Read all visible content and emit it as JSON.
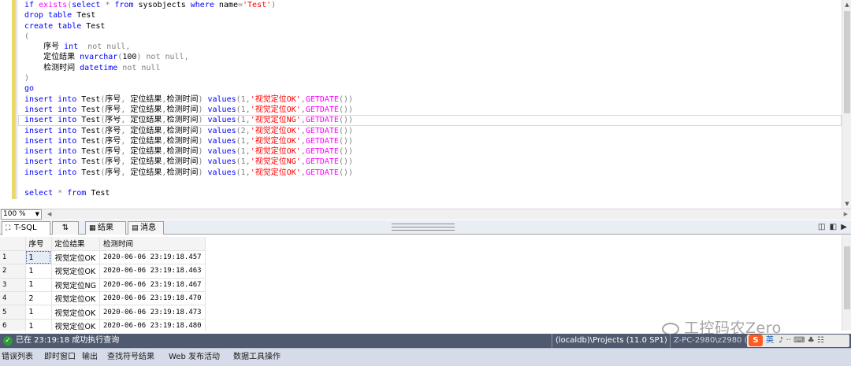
{
  "editor": {
    "lines": [
      [
        {
          "t": "if ",
          "c": "kw"
        },
        {
          "t": "exists",
          "c": "fn"
        },
        {
          "t": "(",
          "c": "gr"
        },
        {
          "t": "select ",
          "c": "kw"
        },
        {
          "t": "* ",
          "c": "gr"
        },
        {
          "t": "from ",
          "c": "kw"
        },
        {
          "t": "sysobjects ",
          "c": ""
        },
        {
          "t": "where ",
          "c": "kw"
        },
        {
          "t": "name",
          "c": ""
        },
        {
          "t": "=",
          "c": "gr"
        },
        {
          "t": "'Test'",
          "c": "str"
        },
        {
          "t": ")",
          "c": "gr"
        }
      ],
      [
        {
          "t": "drop table ",
          "c": "kw"
        },
        {
          "t": "Test",
          "c": ""
        }
      ],
      [
        {
          "t": "create table ",
          "c": "kw"
        },
        {
          "t": "Test",
          "c": ""
        }
      ],
      [
        {
          "t": "(",
          "c": "gr"
        }
      ],
      [
        {
          "t": "    序号 ",
          "c": ""
        },
        {
          "t": "int  ",
          "c": "kw"
        },
        {
          "t": "not null,",
          "c": "gr"
        }
      ],
      [
        {
          "t": "    定位结果 ",
          "c": ""
        },
        {
          "t": "nvarchar",
          "c": "kw"
        },
        {
          "t": "(",
          "c": "gr"
        },
        {
          "t": "100",
          "c": ""
        },
        {
          "t": ") not null,",
          "c": "gr"
        }
      ],
      [
        {
          "t": "    检测时间 ",
          "c": ""
        },
        {
          "t": "datetime ",
          "c": "kw"
        },
        {
          "t": "not null",
          "c": "gr"
        }
      ],
      [
        {
          "t": ")",
          "c": "gr"
        }
      ],
      [
        {
          "t": "go",
          "c": "kw"
        }
      ],
      [
        {
          "t": "insert into ",
          "c": "kw"
        },
        {
          "t": "Test",
          "c": ""
        },
        {
          "t": "(",
          "c": "gr"
        },
        {
          "t": "序号",
          "c": ""
        },
        {
          "t": ", ",
          "c": "gr"
        },
        {
          "t": "定位结果",
          "c": ""
        },
        {
          "t": ",",
          "c": "gr"
        },
        {
          "t": "检测时间",
          "c": ""
        },
        {
          "t": ") ",
          "c": "gr"
        },
        {
          "t": "values",
          "c": "kw"
        },
        {
          "t": "(1,",
          "c": "gr"
        },
        {
          "t": "'视觉定位OK'",
          "c": "str"
        },
        {
          "t": ",",
          "c": "gr"
        },
        {
          "t": "GETDATE",
          "c": "fn"
        },
        {
          "t": "())",
          "c": "gr"
        }
      ],
      [
        {
          "t": "insert into ",
          "c": "kw"
        },
        {
          "t": "Test",
          "c": ""
        },
        {
          "t": "(",
          "c": "gr"
        },
        {
          "t": "序号",
          "c": ""
        },
        {
          "t": ", ",
          "c": "gr"
        },
        {
          "t": "定位结果",
          "c": ""
        },
        {
          "t": ",",
          "c": "gr"
        },
        {
          "t": "检测时间",
          "c": ""
        },
        {
          "t": ") ",
          "c": "gr"
        },
        {
          "t": "values",
          "c": "kw"
        },
        {
          "t": "(1,",
          "c": "gr"
        },
        {
          "t": "'视觉定位OK'",
          "c": "str"
        },
        {
          "t": ",",
          "c": "gr"
        },
        {
          "t": "GETDATE",
          "c": "fn"
        },
        {
          "t": "())",
          "c": "gr"
        }
      ],
      [
        {
          "t": "insert into ",
          "c": "kw"
        },
        {
          "t": "Test",
          "c": ""
        },
        {
          "t": "(",
          "c": "gr"
        },
        {
          "t": "序号",
          "c": ""
        },
        {
          "t": ", ",
          "c": "gr"
        },
        {
          "t": "定位结果",
          "c": ""
        },
        {
          "t": ",",
          "c": "gr"
        },
        {
          "t": "检测时间",
          "c": ""
        },
        {
          "t": ") ",
          "c": "gr"
        },
        {
          "t": "values",
          "c": "kw"
        },
        {
          "t": "(1,",
          "c": "gr"
        },
        {
          "t": "'视觉定位NG'",
          "c": "str"
        },
        {
          "t": ",",
          "c": "gr"
        },
        {
          "t": "GETDATE",
          "c": "fn"
        },
        {
          "t": "())",
          "c": "gr"
        }
      ],
      [
        {
          "t": "insert into ",
          "c": "kw"
        },
        {
          "t": "Test",
          "c": ""
        },
        {
          "t": "(",
          "c": "gr"
        },
        {
          "t": "序号",
          "c": ""
        },
        {
          "t": ", ",
          "c": "gr"
        },
        {
          "t": "定位结果",
          "c": ""
        },
        {
          "t": ",",
          "c": "gr"
        },
        {
          "t": "检测时间",
          "c": ""
        },
        {
          "t": ") ",
          "c": "gr"
        },
        {
          "t": "values",
          "c": "kw"
        },
        {
          "t": "(2,",
          "c": "gr"
        },
        {
          "t": "'视觉定位OK'",
          "c": "str"
        },
        {
          "t": ",",
          "c": "gr"
        },
        {
          "t": "GETDATE",
          "c": "fn"
        },
        {
          "t": "())",
          "c": "gr"
        }
      ],
      [
        {
          "t": "insert into ",
          "c": "kw"
        },
        {
          "t": "Test",
          "c": ""
        },
        {
          "t": "(",
          "c": "gr"
        },
        {
          "t": "序号",
          "c": ""
        },
        {
          "t": ", ",
          "c": "gr"
        },
        {
          "t": "定位结果",
          "c": ""
        },
        {
          "t": ",",
          "c": "gr"
        },
        {
          "t": "检测时间",
          "c": ""
        },
        {
          "t": ") ",
          "c": "gr"
        },
        {
          "t": "values",
          "c": "kw"
        },
        {
          "t": "(1,",
          "c": "gr"
        },
        {
          "t": "'视觉定位OK'",
          "c": "str"
        },
        {
          "t": ",",
          "c": "gr"
        },
        {
          "t": "GETDATE",
          "c": "fn"
        },
        {
          "t": "())",
          "c": "gr"
        }
      ],
      [
        {
          "t": "insert into ",
          "c": "kw"
        },
        {
          "t": "Test",
          "c": ""
        },
        {
          "t": "(",
          "c": "gr"
        },
        {
          "t": "序号",
          "c": ""
        },
        {
          "t": ", ",
          "c": "gr"
        },
        {
          "t": "定位结果",
          "c": ""
        },
        {
          "t": ",",
          "c": "gr"
        },
        {
          "t": "检测时间",
          "c": ""
        },
        {
          "t": ") ",
          "c": "gr"
        },
        {
          "t": "values",
          "c": "kw"
        },
        {
          "t": "(1,",
          "c": "gr"
        },
        {
          "t": "'视觉定位OK'",
          "c": "str"
        },
        {
          "t": ",",
          "c": "gr"
        },
        {
          "t": "GETDATE",
          "c": "fn"
        },
        {
          "t": "())",
          "c": "gr"
        }
      ],
      [
        {
          "t": "insert into ",
          "c": "kw"
        },
        {
          "t": "Test",
          "c": ""
        },
        {
          "t": "(",
          "c": "gr"
        },
        {
          "t": "序号",
          "c": ""
        },
        {
          "t": ", ",
          "c": "gr"
        },
        {
          "t": "定位结果",
          "c": ""
        },
        {
          "t": ",",
          "c": "gr"
        },
        {
          "t": "检测时间",
          "c": ""
        },
        {
          "t": ") ",
          "c": "gr"
        },
        {
          "t": "values",
          "c": "kw"
        },
        {
          "t": "(1,",
          "c": "gr"
        },
        {
          "t": "'视觉定位NG'",
          "c": "str"
        },
        {
          "t": ",",
          "c": "gr"
        },
        {
          "t": "GETDATE",
          "c": "fn"
        },
        {
          "t": "())",
          "c": "gr"
        }
      ],
      [
        {
          "t": "insert into ",
          "c": "kw"
        },
        {
          "t": "Test",
          "c": ""
        },
        {
          "t": "(",
          "c": "gr"
        },
        {
          "t": "序号",
          "c": ""
        },
        {
          "t": ", ",
          "c": "gr"
        },
        {
          "t": "定位结果",
          "c": ""
        },
        {
          "t": ",",
          "c": "gr"
        },
        {
          "t": "检测时间",
          "c": ""
        },
        {
          "t": ") ",
          "c": "gr"
        },
        {
          "t": "values",
          "c": "kw"
        },
        {
          "t": "(1,",
          "c": "gr"
        },
        {
          "t": "'视觉定位OK'",
          "c": "str"
        },
        {
          "t": ",",
          "c": "gr"
        },
        {
          "t": "GETDATE",
          "c": "fn"
        },
        {
          "t": "())",
          "c": "gr"
        }
      ],
      [],
      [
        {
          "t": "select ",
          "c": "kw"
        },
        {
          "t": "* ",
          "c": "gr"
        },
        {
          "t": "from ",
          "c": "kw"
        },
        {
          "t": "Test",
          "c": ""
        }
      ]
    ],
    "current_line": 11
  },
  "zoom": {
    "value": "100 %"
  },
  "tabs": {
    "tsql": "T-SQL",
    "pin": "⇅",
    "results": "结果",
    "messages": "消息"
  },
  "grid": {
    "columns": [
      "",
      "序号",
      "定位结果",
      "检测时间"
    ],
    "rows": [
      [
        "1",
        "1",
        "视觉定位OK",
        "2020-06-06 23:19:18.457"
      ],
      [
        "2",
        "1",
        "视觉定位OK",
        "2020-06-06 23:19:18.463"
      ],
      [
        "3",
        "1",
        "视觉定位NG",
        "2020-06-06 23:19:18.467"
      ],
      [
        "4",
        "2",
        "视觉定位OK",
        "2020-06-06 23:19:18.470"
      ],
      [
        "5",
        "1",
        "视觉定位OK",
        "2020-06-06 23:19:18.473"
      ],
      [
        "6",
        "1",
        "视觉定位OK",
        "2020-06-06 23:19:18.480"
      ]
    ]
  },
  "watermark": {
    "text": "工控码农Zero"
  },
  "status": {
    "message": "已在 23:19:18 成功执行查询",
    "server": "(localdb)\\Projects (11.0 SP1)",
    "user": "Z-PC-2980\\z2980 (52"
  },
  "ime": {
    "s": "S",
    "lang": "英",
    "icons": "♪ ·· ⌨ ♣ ☷"
  },
  "bottom_tabs": [
    "错误列表",
    "即时窗口",
    "输出",
    "查找符号结果",
    "Web 发布活动",
    "数据工具操作"
  ],
  "colors": {
    "keyword": "#0000ff",
    "string": "#ff0000",
    "function": "#ff00ff",
    "status_bg": "#505a6e",
    "ok_green": "#2e9b38"
  }
}
